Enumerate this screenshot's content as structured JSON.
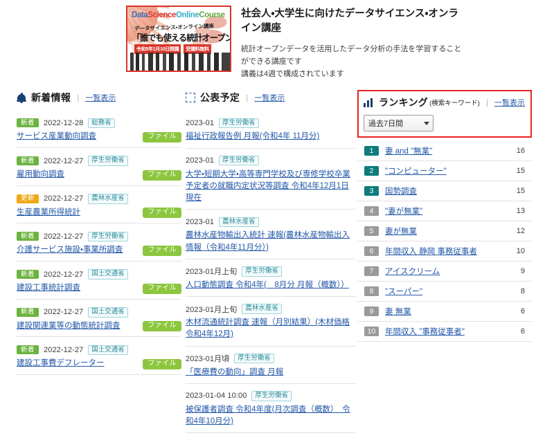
{
  "promo": {
    "banner": {
      "title_en_parts": [
        {
          "text": "Data",
          "color": "#3d6fb5"
        },
        {
          "text": "Science",
          "color": "#d8352a"
        },
        {
          "text": "Online",
          "color": "#38b0c9"
        },
        {
          "text": "Course",
          "color": "#62a73b"
        }
      ],
      "subtitle_jp": "データサイエンス・オンライン講座",
      "headline_jp": "「誰でも使える統計オープンデータ」",
      "pill_left": "令和5年1月10日開講",
      "pill_right": "受講料無料"
    },
    "title": "社会人・大学生に向けたデータサイエンス・オンライン講座",
    "description_line1": "統計オープンデータを活用したデータ分析の手法を学習することができる講座です",
    "description_line2": "講義は4週で構成されています"
  },
  "news": {
    "icon": "bell-icon",
    "title": "新着情報",
    "divider": "|",
    "list_link": "一覧表示",
    "items": [
      {
        "tag": "新着",
        "tag_type": "new",
        "date": "2022-12-28",
        "org": "総務省",
        "title": "サービス産業動向調査",
        "file": "ファイル"
      },
      {
        "tag": "新着",
        "tag_type": "new",
        "date": "2022-12-27",
        "org": "厚生労働省",
        "title": "雇用動向調査",
        "file": "ファイル"
      },
      {
        "tag": "更新",
        "tag_type": "update",
        "date": "2022-12-27",
        "org": "農林水産省",
        "title": "生産農業所得統計",
        "file": "ファイル"
      },
      {
        "tag": "新着",
        "tag_type": "new",
        "date": "2022-12-27",
        "org": "厚生労働省",
        "title": "介護サービス施設・事業所調査",
        "file": "ファイル"
      },
      {
        "tag": "新着",
        "tag_type": "new",
        "date": "2022-12-27",
        "org": "国土交通省",
        "title": "建設工事統計調査",
        "file": "ファイル"
      },
      {
        "tag": "新着",
        "tag_type": "new",
        "date": "2022-12-27",
        "org": "国土交通省",
        "title": "建設関連業等の動態統計調査",
        "file": "ファイル"
      },
      {
        "tag": "新着",
        "tag_type": "new",
        "date": "2022-12-27",
        "org": "国土交通省",
        "title": "建設工事費デフレーター",
        "file": "ファイル"
      }
    ]
  },
  "schedule": {
    "icon": "calendar-icon",
    "title": "公表予定",
    "divider": "|",
    "list_link": "一覧表示",
    "items": [
      {
        "date": "2023-01",
        "org": "厚生労働省",
        "title": "福祉行政報告例 月報(令和4年 11月分)"
      },
      {
        "date": "2023-01",
        "org": "厚生労働省",
        "title": "大学・短期大学・高等専門学校及び専修学校卒業予定者の就職内定状況等調査 令和4年12月1日現在"
      },
      {
        "date": "2023-01",
        "org": "農林水産省",
        "title": "農林水産物輸出入統計 速報(農林水産物輸出入情報（令和4年11月分）)"
      },
      {
        "date": "2023-01月上旬",
        "org": "厚生労働省",
        "title": "人口動態調査 令和4年(　8月分 月報（概数））"
      },
      {
        "date": "2023-01月上旬",
        "org": "農林水産省",
        "title": "木材流通統計調査 速報（月別結果）(木材価格 令和4年12月)"
      },
      {
        "date": "2023-01月頃",
        "org": "厚生労働省",
        "title": "「医療費の動向」調査 月報"
      },
      {
        "date": "2023-01-04 10:00",
        "org": "厚生労働省",
        "title": "被保護者調査 令和4年度(月次調査（概数）　令和4年10月分)"
      }
    ]
  },
  "ranking": {
    "icon": "bar-chart-icon",
    "title": "ランキング",
    "subtitle": "(検索キーワード)",
    "divider": "|",
    "list_link": "一覧表示",
    "highlight_color": "#e8231f",
    "period_select": {
      "value": "過去7日間",
      "options": [
        "過去7日間"
      ]
    },
    "items": [
      {
        "rank": "1",
        "keyword": "妻 and \"無業\"",
        "count": "16"
      },
      {
        "rank": "2",
        "keyword": "\"コンピューター\"",
        "count": "15"
      },
      {
        "rank": "3",
        "keyword": "国勢調査",
        "count": "15"
      },
      {
        "rank": "4",
        "keyword": "\"妻が無業\"",
        "count": "13"
      },
      {
        "rank": "5",
        "keyword": "妻が無業",
        "count": "12"
      },
      {
        "rank": "6",
        "keyword": "年間収入 静岡 事務従事者",
        "count": "10"
      },
      {
        "rank": "7",
        "keyword": "アイスクリーム",
        "count": "9"
      },
      {
        "rank": "8",
        "keyword": "\"スーパー\"",
        "count": "8"
      },
      {
        "rank": "9",
        "keyword": "妻 無業",
        "count": "6"
      },
      {
        "rank": "10",
        "keyword": "年間収入 \"事務従事者\"",
        "count": "6"
      }
    ]
  }
}
